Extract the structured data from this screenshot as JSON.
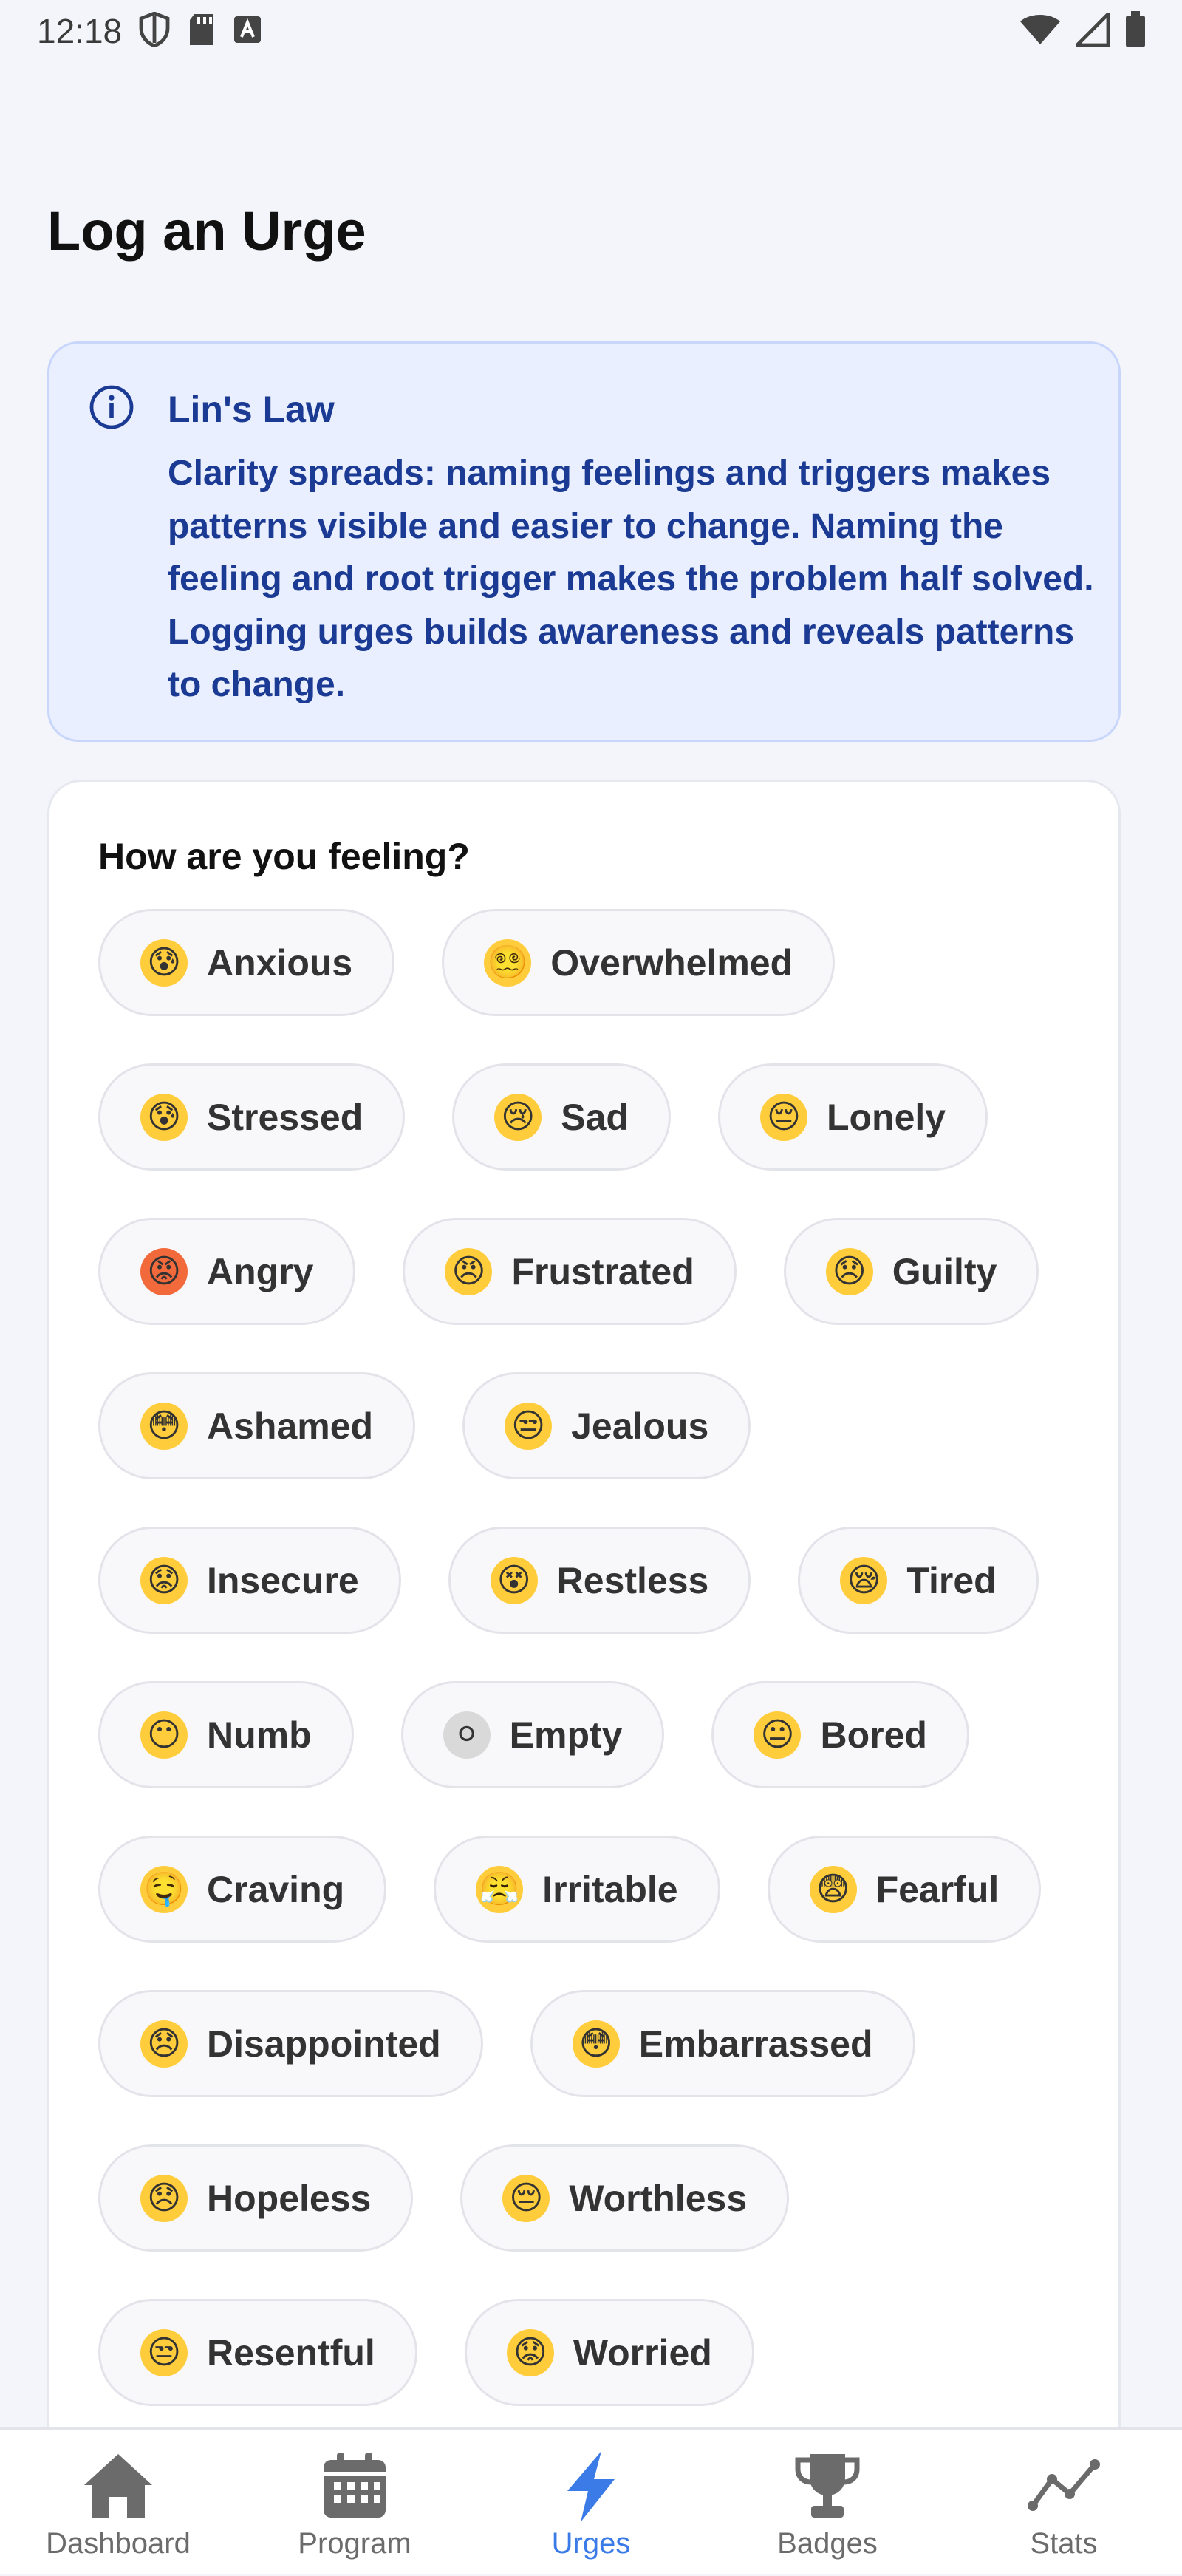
{
  "status_bar": {
    "time": "12:18"
  },
  "page": {
    "title": "Log an Urge"
  },
  "info_card": {
    "icon": "info-icon",
    "title": "Lin's Law",
    "body": "Clarity spreads: naming feelings and triggers makes patterns visible and easier to change. Naming the feeling and root trigger makes the problem half solved. Logging urges builds awareness and reveals patterns to change."
  },
  "feelings": {
    "title": "How are you feeling?",
    "options": [
      {
        "label": "Anxious",
        "emoji": "😰"
      },
      {
        "label": "Overwhelmed",
        "emoji": "😵‍💫"
      },
      {
        "label": "Stressed",
        "emoji": "😰"
      },
      {
        "label": "Sad",
        "emoji": "😢"
      },
      {
        "label": "Lonely",
        "emoji": "😔"
      },
      {
        "label": "Angry",
        "emoji": "😡"
      },
      {
        "label": "Frustrated",
        "emoji": "😠"
      },
      {
        "label": "Guilty",
        "emoji": "😞"
      },
      {
        "label": "Ashamed",
        "emoji": "😳"
      },
      {
        "label": "Jealous",
        "emoji": "😒"
      },
      {
        "label": "Insecure",
        "emoji": "😟"
      },
      {
        "label": "Restless",
        "emoji": "😵"
      },
      {
        "label": "Tired",
        "emoji": "😪"
      },
      {
        "label": "Numb",
        "emoji": "😶"
      },
      {
        "label": "Empty",
        "emoji": "⚪"
      },
      {
        "label": "Bored",
        "emoji": "😐"
      },
      {
        "label": "Craving",
        "emoji": "🤤"
      },
      {
        "label": "Irritable",
        "emoji": "😤"
      },
      {
        "label": "Fearful",
        "emoji": "😨"
      },
      {
        "label": "Disappointed",
        "emoji": "😞"
      },
      {
        "label": "Embarrassed",
        "emoji": "😳"
      },
      {
        "label": "Hopeless",
        "emoji": "😞"
      },
      {
        "label": "Worthless",
        "emoji": "😔"
      },
      {
        "label": "Resentful",
        "emoji": "😒"
      },
      {
        "label": "Worried",
        "emoji": "😟"
      }
    ]
  },
  "bottom_nav": {
    "items": [
      {
        "label": "Dashboard",
        "icon": "home-icon"
      },
      {
        "label": "Program",
        "icon": "calendar-icon"
      },
      {
        "label": "Urges",
        "icon": "lightning-icon",
        "active": true
      },
      {
        "label": "Badges",
        "icon": "trophy-icon"
      },
      {
        "label": "Stats",
        "icon": "chart-line-icon"
      }
    ]
  },
  "colors": {
    "accent": "#3b7be8",
    "info_bg": "#e9effe",
    "info_text": "#1b3a93",
    "nav_inactive": "#6b6b6b"
  }
}
